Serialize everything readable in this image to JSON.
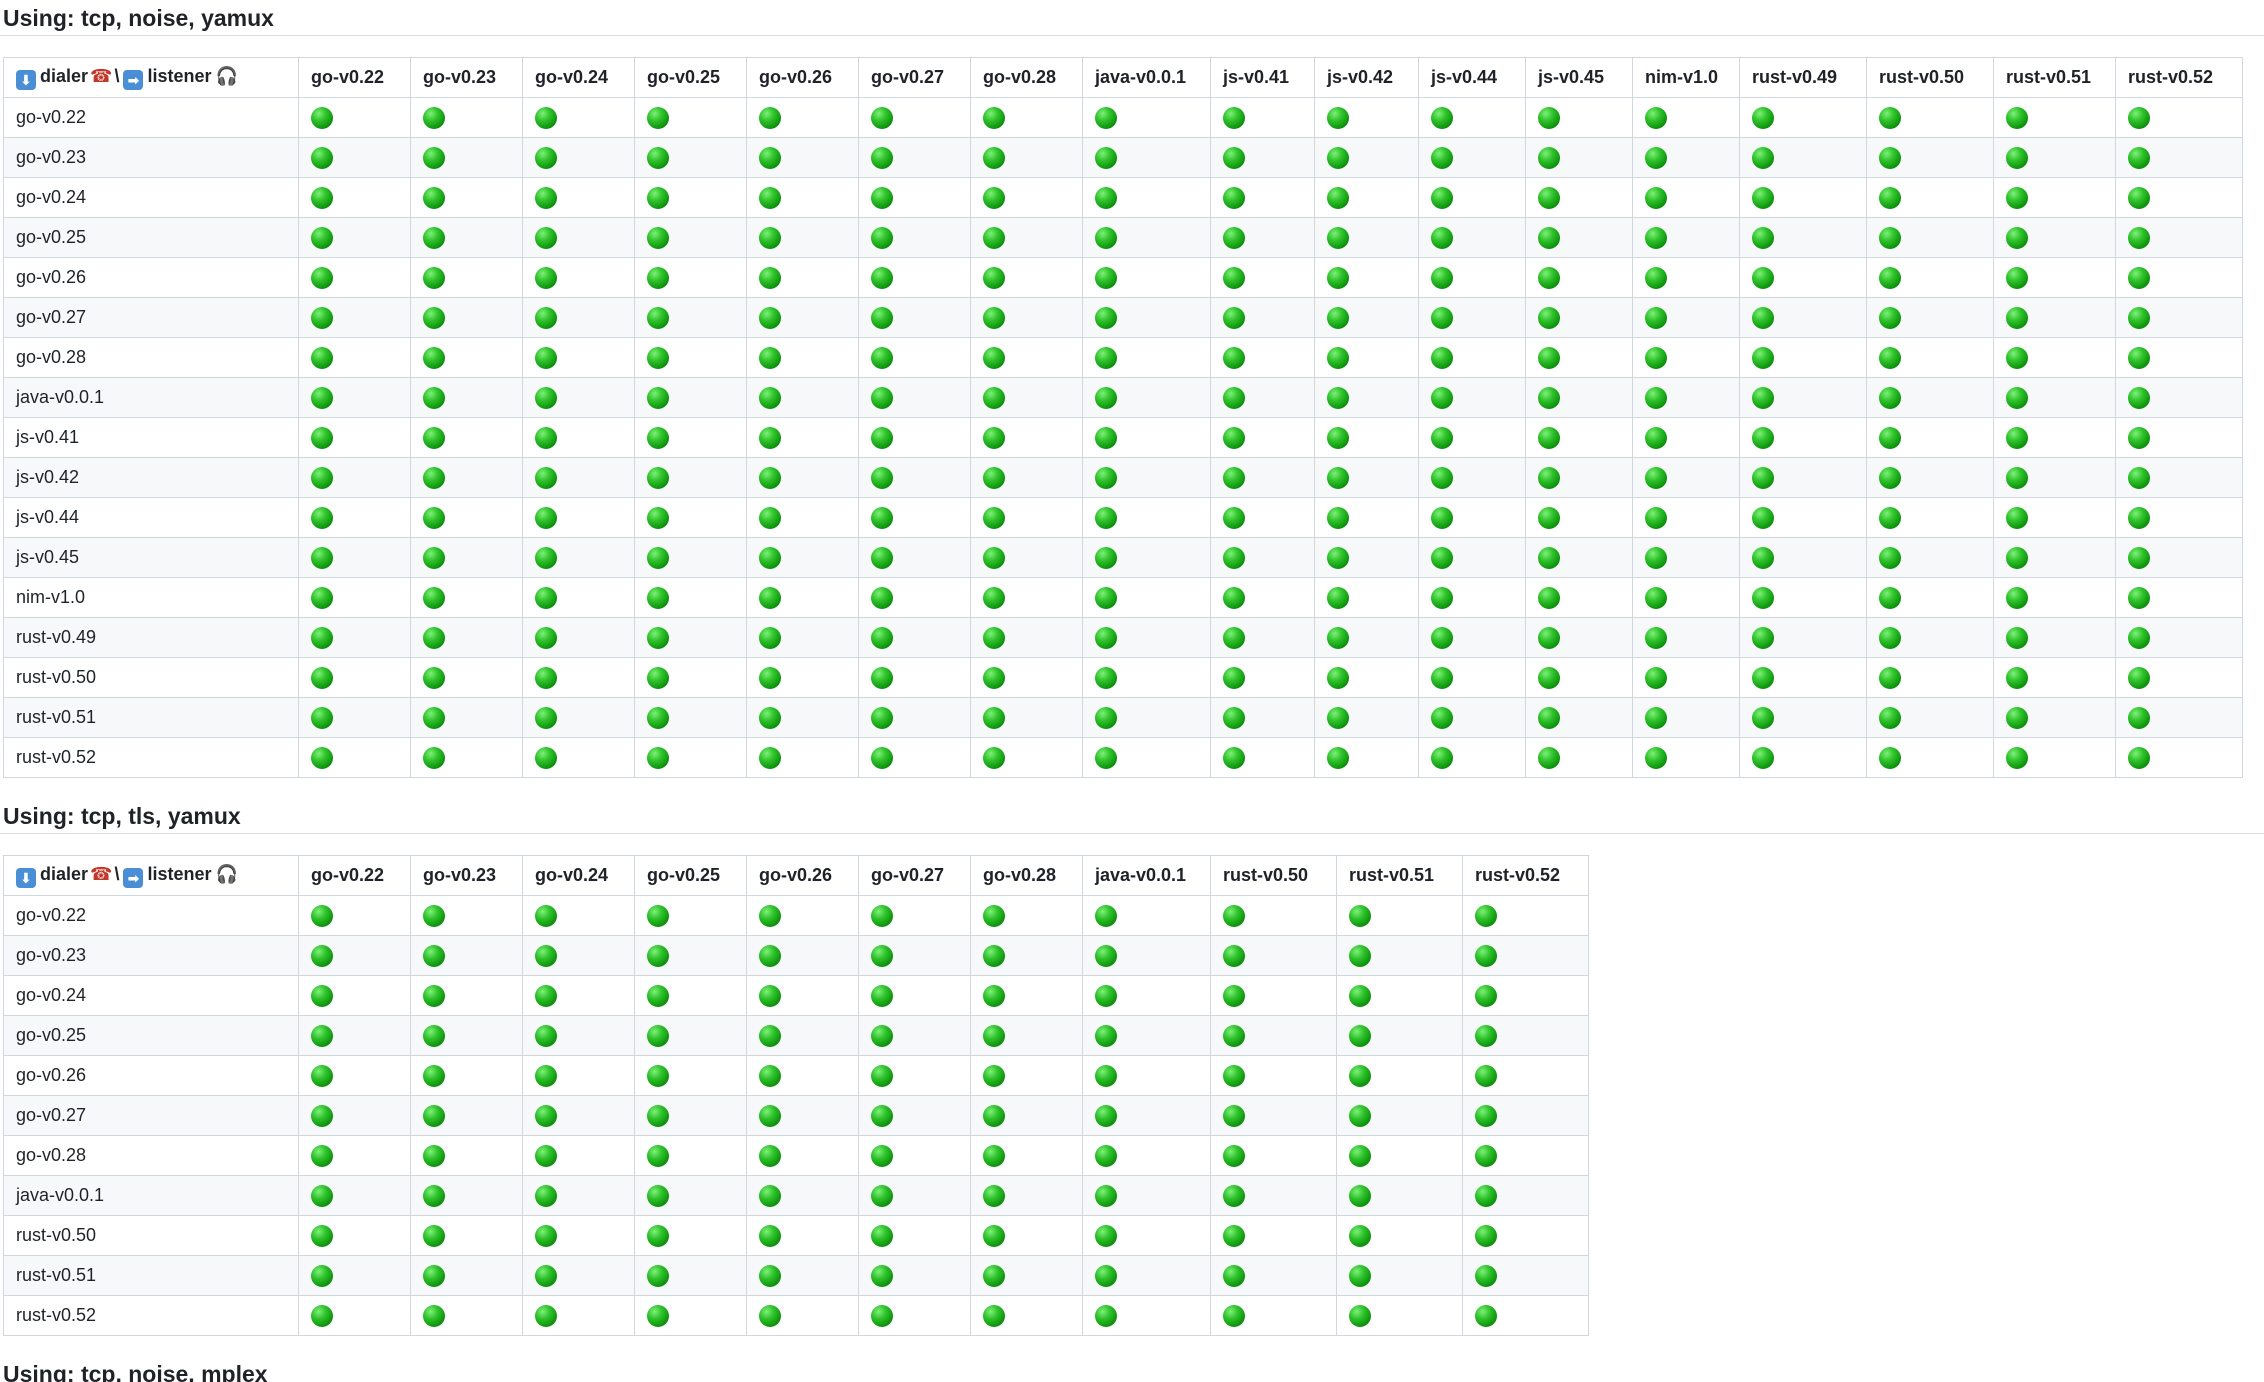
{
  "sections": [
    {
      "heading": "Using: tcp, noise, yamux",
      "corner": {
        "dialer": "dialer",
        "sep": "\\",
        "listener": "listener"
      },
      "columns": [
        "go-v0.22",
        "go-v0.23",
        "go-v0.24",
        "go-v0.25",
        "go-v0.26",
        "go-v0.27",
        "go-v0.28",
        "java-v0.0.1",
        "js-v0.41",
        "js-v0.42",
        "js-v0.44",
        "js-v0.45",
        "nim-v1.0",
        "rust-v0.49",
        "rust-v0.50",
        "rust-v0.51",
        "rust-v0.52"
      ],
      "rows": [
        "go-v0.22",
        "go-v0.23",
        "go-v0.24",
        "go-v0.25",
        "go-v0.26",
        "go-v0.27",
        "go-v0.28",
        "java-v0.0.1",
        "js-v0.41",
        "js-v0.42",
        "js-v0.44",
        "js-v0.45",
        "nim-v1.0",
        "rust-v0.49",
        "rust-v0.50",
        "rust-v0.51",
        "rust-v0.52"
      ],
      "cell_status": "success"
    },
    {
      "heading": "Using: tcp, tls, yamux",
      "corner": {
        "dialer": "dialer",
        "sep": "\\",
        "listener": "listener"
      },
      "columns": [
        "go-v0.22",
        "go-v0.23",
        "go-v0.24",
        "go-v0.25",
        "go-v0.26",
        "go-v0.27",
        "go-v0.28",
        "java-v0.0.1",
        "rust-v0.50",
        "rust-v0.51",
        "rust-v0.52"
      ],
      "rows": [
        "go-v0.22",
        "go-v0.23",
        "go-v0.24",
        "go-v0.25",
        "go-v0.26",
        "go-v0.27",
        "go-v0.28",
        "java-v0.0.1",
        "rust-v0.50",
        "rust-v0.51",
        "rust-v0.52"
      ],
      "cell_status": "success"
    }
  ],
  "next_heading": "Using: tcp, noise, mplex",
  "icons": {
    "dialer_arrow": "down-arrow-icon",
    "phone": "telephone-icon",
    "listener_arrow": "right-arrow-icon",
    "headphones": "headphone-icon",
    "status": "green-circle-icon"
  },
  "colors": {
    "status_green": "#1fb51c",
    "border": "#d0d7de",
    "stripe": "#f6f8fa"
  }
}
